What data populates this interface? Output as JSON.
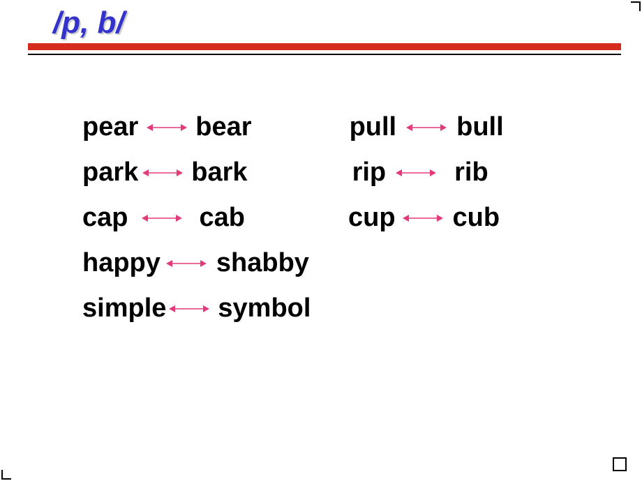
{
  "title": "/p, b/",
  "arrow_color": "#e23a7a",
  "pairs": [
    [
      {
        "left": "pear",
        "right": "bear",
        "gapL": 12,
        "arrowW": 58,
        "gapR": 12
      },
      {
        "left": "pull",
        "right": "bull",
        "pre": 140,
        "gapL": 14,
        "arrowW": 58,
        "gapR": 14
      }
    ],
    [
      {
        "left": "park",
        "right": "bark",
        "gapL": 6,
        "arrowW": 58,
        "gapR": 12
      },
      {
        "left": "rip",
        "right": "rib",
        "pre": 150,
        "gapL": 14,
        "arrowW": 58,
        "gapR": 26
      }
    ],
    [
      {
        "left": "cap",
        "right": "cab",
        "gapL": 20,
        "arrowW": 58,
        "gapR": 24
      },
      {
        "left": "cup",
        "right": "cub",
        "pre": 148,
        "gapL": 10,
        "arrowW": 58,
        "gapR": 14
      }
    ],
    [
      {
        "left": "happy",
        "right": "shabby",
        "gapL": 8,
        "arrowW": 58,
        "gapR": 14
      }
    ],
    [
      {
        "left": "simple",
        "right": "symbol",
        "gapL": 4,
        "arrowW": 58,
        "gapR": 12
      }
    ]
  ]
}
